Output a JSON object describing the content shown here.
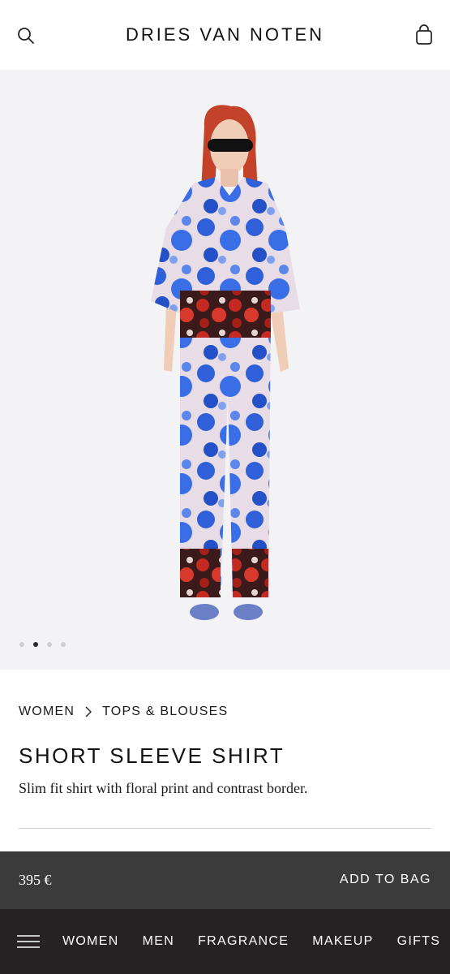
{
  "header": {
    "logo": "DRIES VAN NOTEN",
    "search_icon": "search-icon",
    "bag_icon": "shopping-bag-icon"
  },
  "gallery": {
    "image_count": 4,
    "active_index": 1
  },
  "breadcrumb": {
    "items": [
      "WOMEN",
      "TOPS & BLOUSES"
    ],
    "separator_icon": "chevron-right-icon"
  },
  "product": {
    "title": "SHORT SLEEVE SHIRT",
    "description": "Slim fit shirt with floral print and contrast border.",
    "price": "395 €"
  },
  "buy_bar": {
    "add_label": "ADD TO BAG"
  },
  "bottom_nav": {
    "menu_icon": "hamburger-menu-icon",
    "items": [
      "WOMEN",
      "MEN",
      "FRAGRANCE",
      "MAKEUP",
      "GIFTS"
    ]
  },
  "colors": {
    "hero_background": "#f3f2f5",
    "buy_bar_background": "#3b3b3b",
    "nav_background": "#262224",
    "print_blue": "#2f5fd9",
    "print_red": "#c42a22"
  }
}
